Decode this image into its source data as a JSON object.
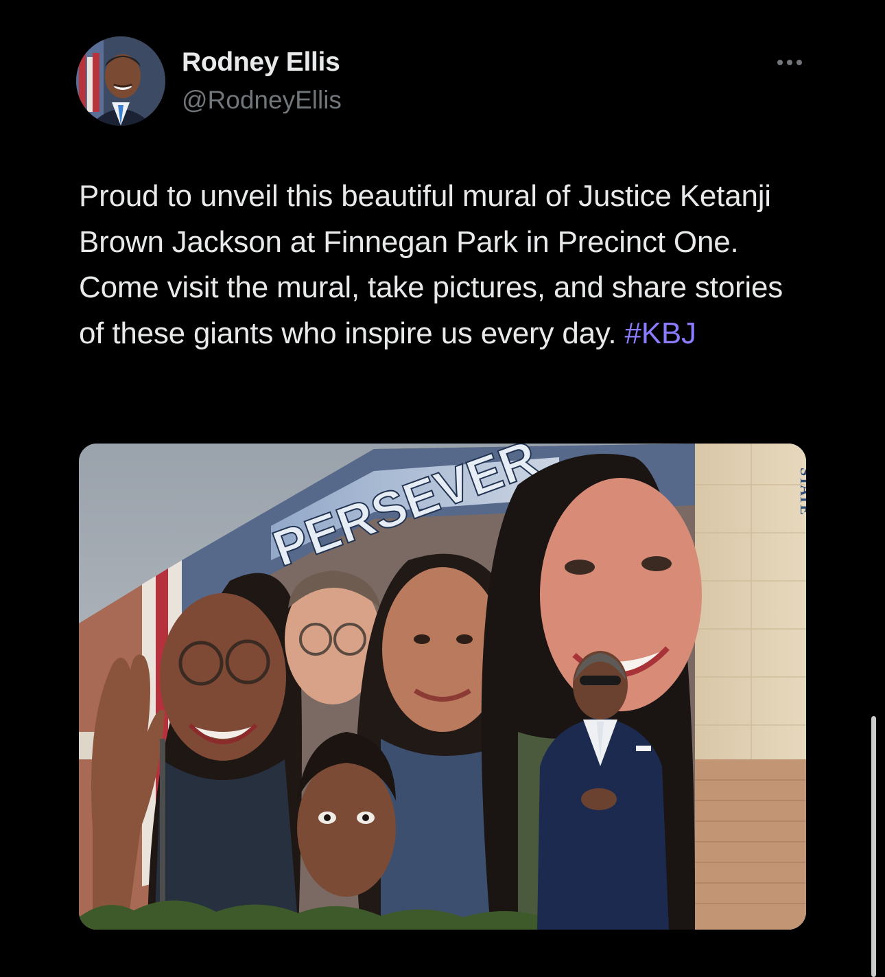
{
  "tweet": {
    "author": {
      "display_name": "Rodney Ellis",
      "handle": "@RodneyEllis"
    },
    "more_icon": "ellipsis-icon",
    "text": {
      "body": "Proud to unveil this beautiful mural of Justice Ketanji Brown Jackson at Finnegan Park in Precinct One. Come visit the mural, take pictures, and share stories of these giants who inspire us every day. ",
      "hashtag": "#KBJ"
    },
    "media": {
      "mural_word": "PERSEVER",
      "building_sign": "STATE"
    }
  },
  "colors": {
    "background": "#000000",
    "text_primary": "#e7e9ea",
    "text_secondary": "#71767b",
    "hashtag": "#8a7cff"
  }
}
